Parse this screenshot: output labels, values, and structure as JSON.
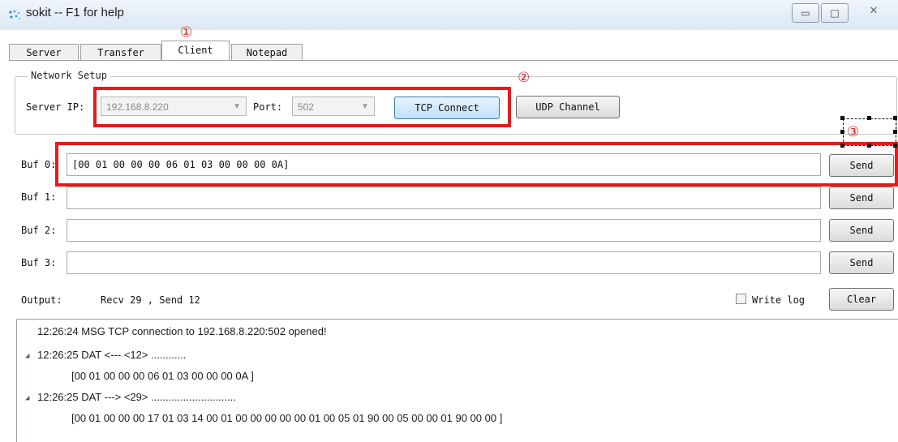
{
  "window": {
    "title": "sokit -- F1 for help",
    "min_symbol": "▭",
    "max_symbol": "□",
    "close_symbol": "✕"
  },
  "tabs": [
    {
      "label": "Server"
    },
    {
      "label": "Transfer"
    },
    {
      "label": "Client",
      "active": true
    },
    {
      "label": "Notepad"
    }
  ],
  "network_setup": {
    "group_label": "Network Setup",
    "server_ip_label": "Server IP:",
    "server_ip_value": "192.168.8.220",
    "port_label": "Port:",
    "port_value": "502",
    "tcp_connect_label": "TCP Connect",
    "udp_channel_label": "UDP Channel"
  },
  "buffers": [
    {
      "label": "Buf 0:",
      "value": "[00 01 00 00 00 06 01 03 00 00 00 0A]",
      "send_label": "Send"
    },
    {
      "label": "Buf 1:",
      "value": "",
      "send_label": "Send"
    },
    {
      "label": "Buf 2:",
      "value": "",
      "send_label": "Send"
    },
    {
      "label": "Buf 3:",
      "value": "",
      "send_label": "Send"
    }
  ],
  "output": {
    "label": "Output:",
    "stats": "Recv 29 , Send 12",
    "write_log_label": "Write log",
    "write_log_checked": false,
    "clear_label": "Clear",
    "lines": [
      "12:26:24 MSG TCP connection to 192.168.8.220:502 opened!",
      "12:26:25 DAT <--- <12> ............",
      "[00 01 00 00 00 06 01 03 00 00 00 0A ]",
      "12:26:25 DAT ---> <29> .............................",
      "[00 01 00 00 00 17 01 03 14 00 01 00 00 00 00 00 01 00 05 01 90 00 05 00 00 01 90 00 00 ]"
    ]
  },
  "annotations": {
    "one": "①",
    "two": "②",
    "three": "③"
  },
  "colors": {
    "annotation_red": "#e51b1b",
    "tcp_button_blue": "#bfe0f7"
  }
}
